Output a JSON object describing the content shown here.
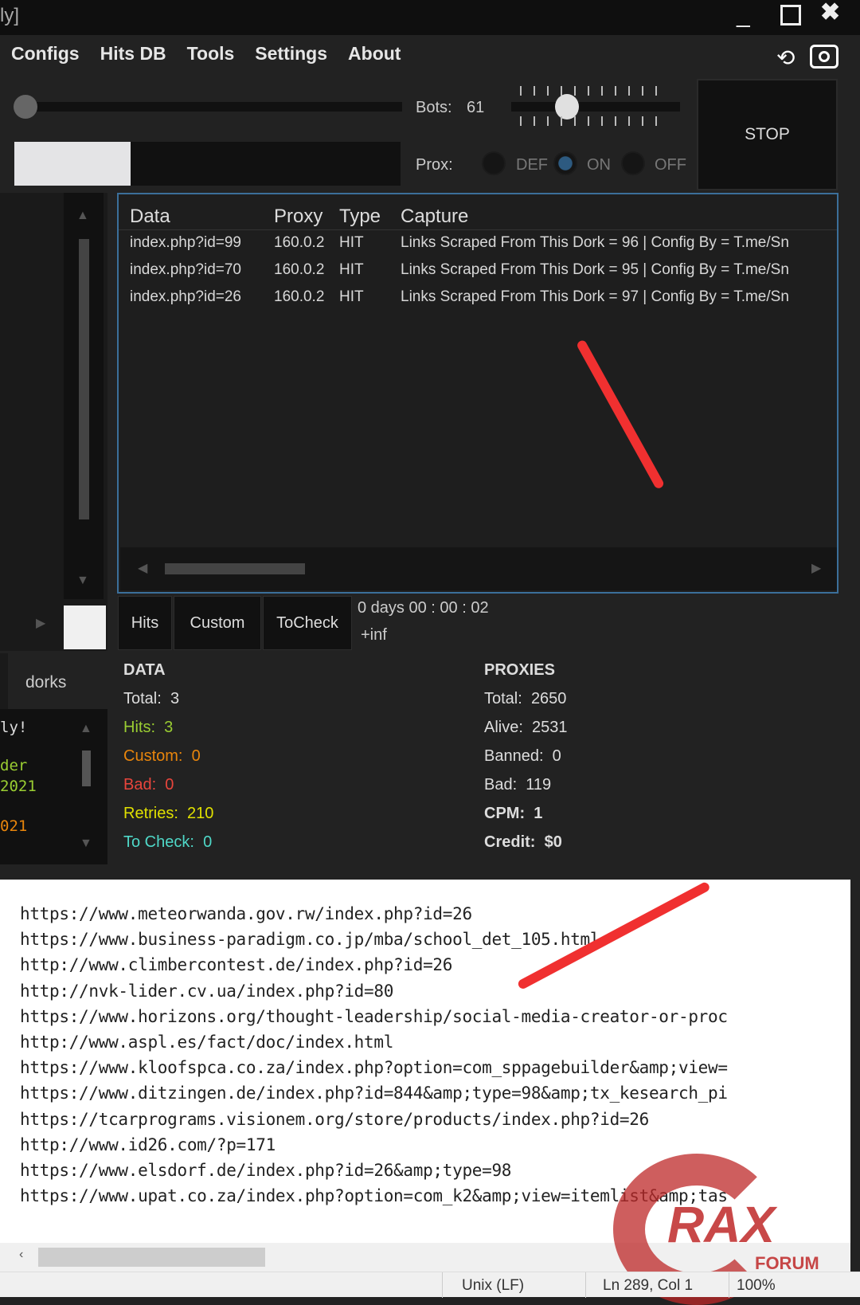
{
  "window": {
    "title_fragment": "ly]"
  },
  "menu": [
    "Configs",
    "Hits DB",
    "Tools",
    "Settings",
    "About"
  ],
  "icons": [
    "history-icon",
    "camera-icon"
  ],
  "controls": {
    "bots_label": "Bots:",
    "bots_value": "61",
    "bots_slider_fraction": 0.34,
    "prox_label": "Prox:",
    "prox_options": [
      "DEF",
      "ON",
      "OFF"
    ],
    "prox_selected": "ON",
    "stop_label": "STOP",
    "progress_fraction": 0.3
  },
  "table": {
    "headers": [
      "Data",
      "Proxy",
      "Type",
      "Capture"
    ],
    "rows": [
      {
        "data": "index.php?id=99",
        "proxy": "160.0.2",
        "type": "HIT",
        "capture": "Links Scraped From This Dork = 96 | Config By  = T.me/Sn"
      },
      {
        "data": "index.php?id=70",
        "proxy": "160.0.2",
        "type": "HIT",
        "capture": "Links Scraped From This Dork = 95 | Config By  = T.me/Sn"
      },
      {
        "data": "index.php?id=26",
        "proxy": "160.0.2",
        "type": "HIT",
        "capture": "Links Scraped From This Dork = 97 | Config By  = T.me/Sn"
      }
    ]
  },
  "tabs": [
    "Hits",
    "Custom",
    "ToCheck"
  ],
  "timer": "0  days  00  :  00  :  02",
  "rate": "+inf",
  "left": {
    "tab": "dorks",
    "log": [
      "ly!",
      "der",
      "2021",
      "021"
    ]
  },
  "data_stats": {
    "title": "DATA",
    "items": [
      {
        "label": "Total:",
        "value": "3",
        "color": "#dddddd"
      },
      {
        "label": "Hits:",
        "value": "3",
        "color": "#9acd32"
      },
      {
        "label": "Custom:",
        "value": "0",
        "color": "#e8850c"
      },
      {
        "label": "Bad:",
        "value": "0",
        "color": "#e8453c"
      },
      {
        "label": "Retries:",
        "value": "210",
        "color": "#e0e000"
      },
      {
        "label": "To Check:",
        "value": "0",
        "color": "#4fd8c8"
      }
    ]
  },
  "proxy_stats": {
    "title": "PROXIES",
    "items": [
      {
        "label": "Total:",
        "value": "2650"
      },
      {
        "label": "Alive:",
        "value": "2531"
      },
      {
        "label": "Banned:",
        "value": "0"
      },
      {
        "label": "Bad:",
        "value": "119"
      },
      {
        "label": "CPM:",
        "value": "1"
      },
      {
        "label": "Credit:",
        "value": "$0"
      }
    ]
  },
  "editor": {
    "lines": [
      "https://www.meteorwanda.gov.rw/index.php?id=26",
      "https://www.business-paradigm.co.jp/mba/school_det_105.html",
      "http://www.climbercontest.de/index.php?id=26",
      "http://nvk-lider.cv.ua/index.php?id=80",
      "https://www.horizons.org/thought-leadership/social-media-creator-or-proc",
      "http://www.aspl.es/fact/doc/index.html",
      "https://www.kloofspca.co.za/index.php?option=com_sppagebuilder&amp;view=",
      "https://www.ditzingen.de/index.php?id=844&amp;type=98&amp;tx_kesearch_pi",
      "https://tcarprograms.visionem.org/store/products/index.php?id=26",
      "http://www.id26.com/?p=171",
      "https://www.elsdorf.de/index.php?id=26&amp;type=98",
      "https://www.upat.co.za/index.php?option=com_k2&amp;view=itemlist&amp;tas"
    ]
  },
  "statusbar": {
    "eol": "Unix (LF)",
    "position": "Ln 289, Col 1",
    "zoom": "100%"
  },
  "watermark": {
    "text": "RAX",
    "sub": "FORUM"
  }
}
